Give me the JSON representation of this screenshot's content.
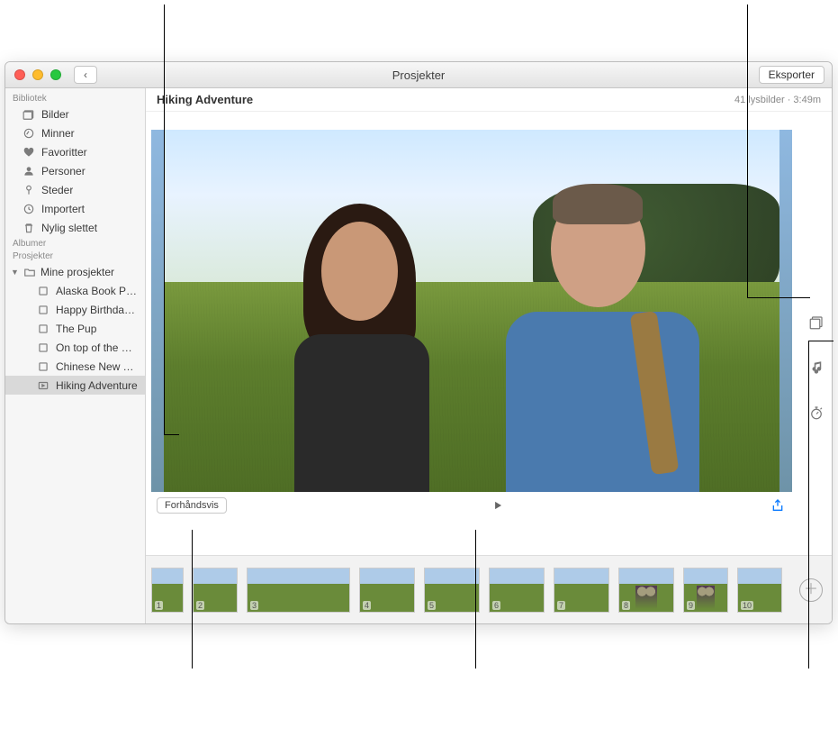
{
  "window": {
    "title": "Prosjekter",
    "export_button": "Eksporter",
    "back_glyph": "‹"
  },
  "sidebar": {
    "sections": {
      "library": "Bibliotek",
      "albums": "Albumer",
      "projects": "Prosjekter"
    },
    "library_items": [
      {
        "label": "Bilder",
        "icon": "photos"
      },
      {
        "label": "Minner",
        "icon": "memories"
      },
      {
        "label": "Favoritter",
        "icon": "heart"
      },
      {
        "label": "Personer",
        "icon": "person"
      },
      {
        "label": "Steder",
        "icon": "pin"
      },
      {
        "label": "Importert",
        "icon": "clock"
      },
      {
        "label": "Nylig slettet",
        "icon": "trash"
      }
    ],
    "my_projects_label": "Mine prosjekter",
    "project_items": [
      {
        "label": "Alaska Book Proj…"
      },
      {
        "label": "Happy Birthday…"
      },
      {
        "label": "The Pup"
      },
      {
        "label": "On top of the W…"
      },
      {
        "label": "Chinese New Year"
      },
      {
        "label": "Hiking Adventure",
        "selected": true
      }
    ]
  },
  "project": {
    "title": "Hiking Adventure",
    "meta_slides": "41 lysbilder",
    "meta_sep": " · ",
    "meta_duration": "3:49m"
  },
  "controls": {
    "preview_label": "Forhåndsvis"
  },
  "thumbnails": {
    "numbers": [
      "1",
      "2",
      "3",
      "4",
      "5",
      "6",
      "7",
      "8",
      "9",
      "10"
    ]
  }
}
